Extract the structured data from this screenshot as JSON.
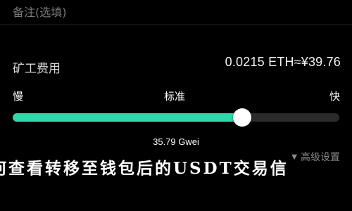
{
  "memo": {
    "label": "备注(选填)"
  },
  "fee": {
    "label": "矿工费用",
    "value": "0.0215 ETH≈¥39.76"
  },
  "speed": {
    "slow_label": "慢",
    "standard_label": "标准",
    "fast_label": "快",
    "level_fraction": 0.702,
    "gwei_text": "35.79 Gwei",
    "accent_color": "#2ed8a8"
  },
  "advanced": {
    "label": "高级设置",
    "icon": "caret-down-icon"
  },
  "overlay": {
    "title": "何查看转移至钱包后的USDT交易信"
  }
}
